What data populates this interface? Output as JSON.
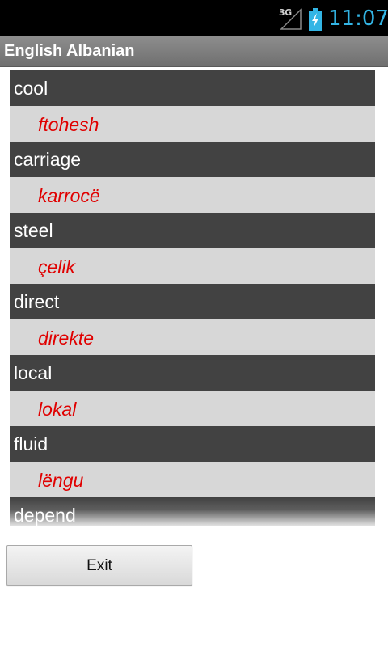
{
  "status_bar": {
    "network": "3G",
    "time": "11:07",
    "signal_icon": "signal-icon",
    "battery_icon": "battery-charging-icon"
  },
  "title_bar": {
    "title": "English Albanian"
  },
  "entries": [
    {
      "word": "cool",
      "translation": "ftohesh"
    },
    {
      "word": "carriage",
      "translation": "karrocë"
    },
    {
      "word": "steel",
      "translation": "çelik"
    },
    {
      "word": "direct",
      "translation": "direkte"
    },
    {
      "word": "local",
      "translation": "lokal"
    },
    {
      "word": "fluid",
      "translation": "lëngu"
    },
    {
      "word": "depend",
      "translation": ""
    }
  ],
  "exit_button": {
    "label": "Exit"
  },
  "colors": {
    "word_bg": "#424242",
    "translation_bg": "#d7d7d7",
    "translation_text": "#e00000",
    "clock": "#33b5e5"
  }
}
